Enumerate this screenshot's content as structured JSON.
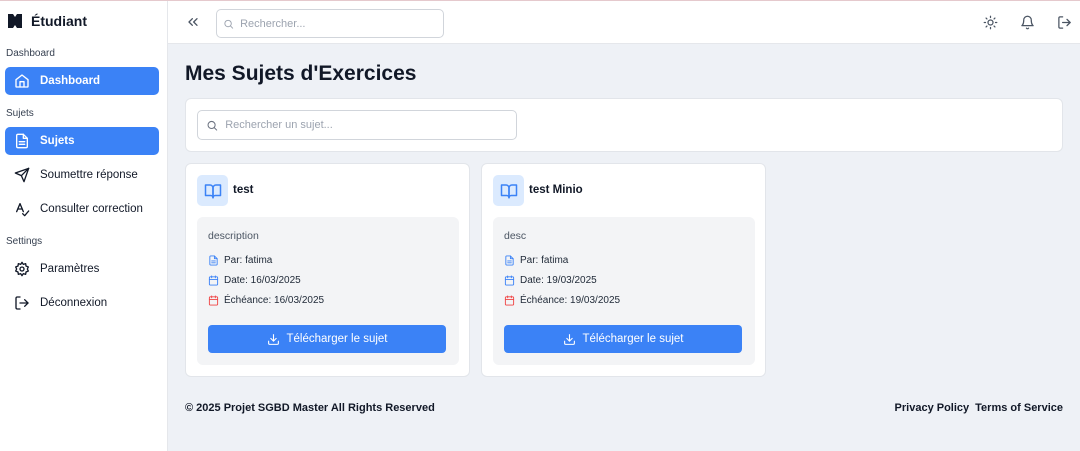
{
  "app": {
    "title": "Étudiant"
  },
  "sidebar": {
    "sections": [
      {
        "label": "Dashboard"
      },
      {
        "label": "Sujets"
      },
      {
        "label": "Settings"
      }
    ],
    "items": [
      {
        "label": "Dashboard",
        "icon": "home-icon",
        "active": false
      },
      {
        "label": "Sujets",
        "icon": "document-icon",
        "active": true
      },
      {
        "label": "Soumettre réponse",
        "icon": "send-icon",
        "active": false
      },
      {
        "label": "Consulter correction",
        "icon": "spellcheck-icon",
        "active": false
      },
      {
        "label": "Paramètres",
        "icon": "gear-icon",
        "active": false
      },
      {
        "label": "Déconnexion",
        "icon": "logout-icon",
        "active": false
      }
    ]
  },
  "topbar": {
    "search_placeholder": "Rechercher...",
    "icons": [
      "collapse-icon",
      "sun-icon",
      "bell-icon",
      "logout-icon"
    ]
  },
  "main": {
    "title": "Mes Sujets d'Exercices",
    "search_placeholder": "Rechercher un sujet...",
    "cards": [
      {
        "title": "test",
        "description": "description",
        "author": "Par: fatima",
        "date": "Date: 16/03/2025",
        "deadline": "Échéance: 16/03/2025",
        "button": "Télécharger le sujet"
      },
      {
        "title": "test Minio",
        "description": "desc",
        "author": "Par: fatima",
        "date": "Date: 19/03/2025",
        "deadline": "Échéance: 19/03/2025",
        "button": "Télécharger le sujet"
      }
    ]
  },
  "footer": {
    "copyright": "© 2025 Projet SGBD Master All Rights Reserved",
    "links": [
      "Privacy Policy",
      "Terms of Service"
    ]
  },
  "colors": {
    "accent": "#3b82f6",
    "icon_bg": "#dbeafe",
    "deadline_icon": "#ef4444",
    "page_bg": "#eef1f6"
  }
}
